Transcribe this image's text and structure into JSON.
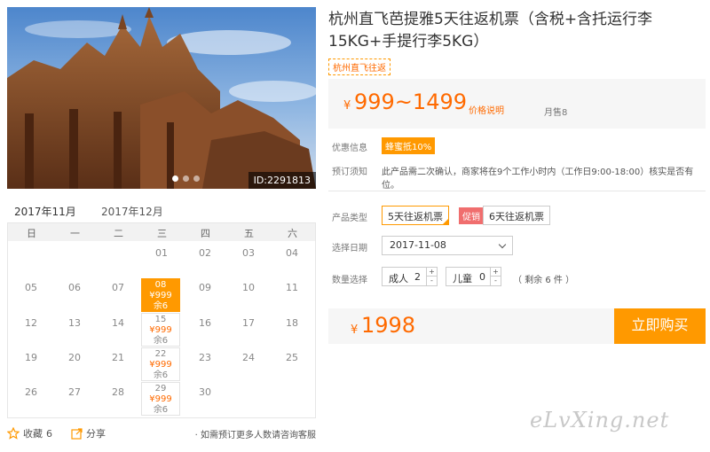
{
  "product": {
    "title": "杭州直飞芭提雅5天往返机票（含税+含托运行李15KG+手提行李5KG）",
    "route_tag": "杭州直飞往返",
    "image_id": "ID:2291813"
  },
  "price": {
    "currency": "¥",
    "range": "999~1499",
    "note": "价格说明",
    "sold": "月售8"
  },
  "info": {
    "discount_label": "优惠信息",
    "discount_badge": "蜂蜜抵10%",
    "notice_label": "预订须知",
    "notice_text": "此产品需二次确认，商家将在9个工作小时内（工作日9:00-18:00）核实是否有位。"
  },
  "options": {
    "type_label": "产品类型",
    "types": [
      "5天往返机票",
      "6天往返机票"
    ],
    "promo_badge": "促销",
    "date_label": "选择日期",
    "date_value": "2017-11-08",
    "qty_label": "数量选择",
    "adult_label": "成人",
    "adult_value": "2",
    "child_label": "儿童",
    "child_value": "0",
    "plus": "+",
    "minus": "-",
    "remaining": "（ 剩余 6 件 ）"
  },
  "total": {
    "currency": "¥",
    "value": "1998",
    "buy_label": "立即购买"
  },
  "calendar": {
    "months": [
      "2017年11月",
      "2017年12月"
    ],
    "weekdays": [
      "日",
      "一",
      "二",
      "三",
      "四",
      "五",
      "六"
    ],
    "row1": [
      "01",
      "02",
      "03",
      "04"
    ],
    "row2": [
      "05",
      "06",
      "07",
      "09",
      "10",
      "11"
    ],
    "row3": [
      "12",
      "13",
      "14",
      "16",
      "17",
      "18"
    ],
    "row4": [
      "19",
      "20",
      "21",
      "23",
      "24",
      "25"
    ],
    "row5": [
      "26",
      "27",
      "28",
      "30"
    ],
    "priced": [
      {
        "day": "08",
        "price": "¥999",
        "stock": "余6"
      },
      {
        "day": "15",
        "price": "¥999",
        "stock": "余6"
      },
      {
        "day": "22",
        "price": "¥999",
        "stock": "余6"
      },
      {
        "day": "29",
        "price": "¥999",
        "stock": "余6"
      }
    ]
  },
  "footer": {
    "favorite_label": "收藏",
    "favorite_count": "6",
    "share_label": "分享",
    "note": "· 如需预订更多人数请咨询客服"
  },
  "watermark": "eLvXing.net",
  "colors": {
    "accent": "#ff9900",
    "price": "#ff6a00",
    "promo": "#f06e6e"
  }
}
